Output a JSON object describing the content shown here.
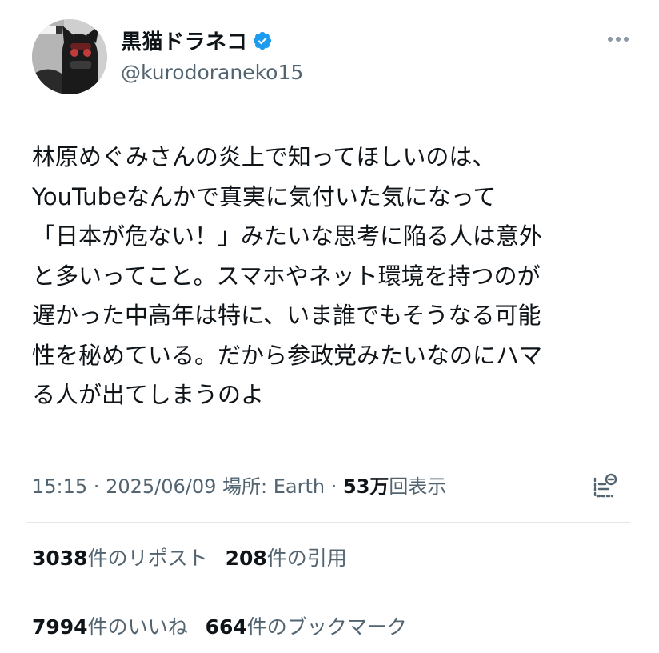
{
  "user": {
    "display_name": "黒猫ドラネコ",
    "handle": "@kurodoraneko15",
    "verified_icon": "verified-badge-icon",
    "avatar": "avatar-cat-mask"
  },
  "tweet": {
    "lines": [
      "林原めぐみさんの炎上で知ってほしいのは、",
      "YouTubeなんかで真実に気付いた気になって",
      "「日本が危ない！」みたいな思考に陥る人は意外",
      "と多いってこと。スマホやネット環境を持つのが",
      "遅かった中高年は特に、いま誰でもそうなる可能",
      "性を秘めている。だから参政党みたいなのにハマ",
      "る人が出てしまうのよ"
    ]
  },
  "meta": {
    "time": "15:15",
    "sep1": " · ",
    "date": "2025/06/09",
    "location_label": "場所: Earth",
    "sep2": " · ",
    "views_num": "53万",
    "views_label": "回表示"
  },
  "stats": {
    "reposts_num": "3038",
    "reposts_label": "件のリポスト",
    "quotes_num": "208",
    "quotes_label": "件の引用",
    "likes_num": "7994",
    "likes_label": "件のいいね",
    "bookmarks_num": "664",
    "bookmarks_label": "件のブックマーク"
  },
  "colors": {
    "text": "#0f1419",
    "secondary": "#536471",
    "verified": "#1d9bf0",
    "divider": "#e3e6e9"
  }
}
